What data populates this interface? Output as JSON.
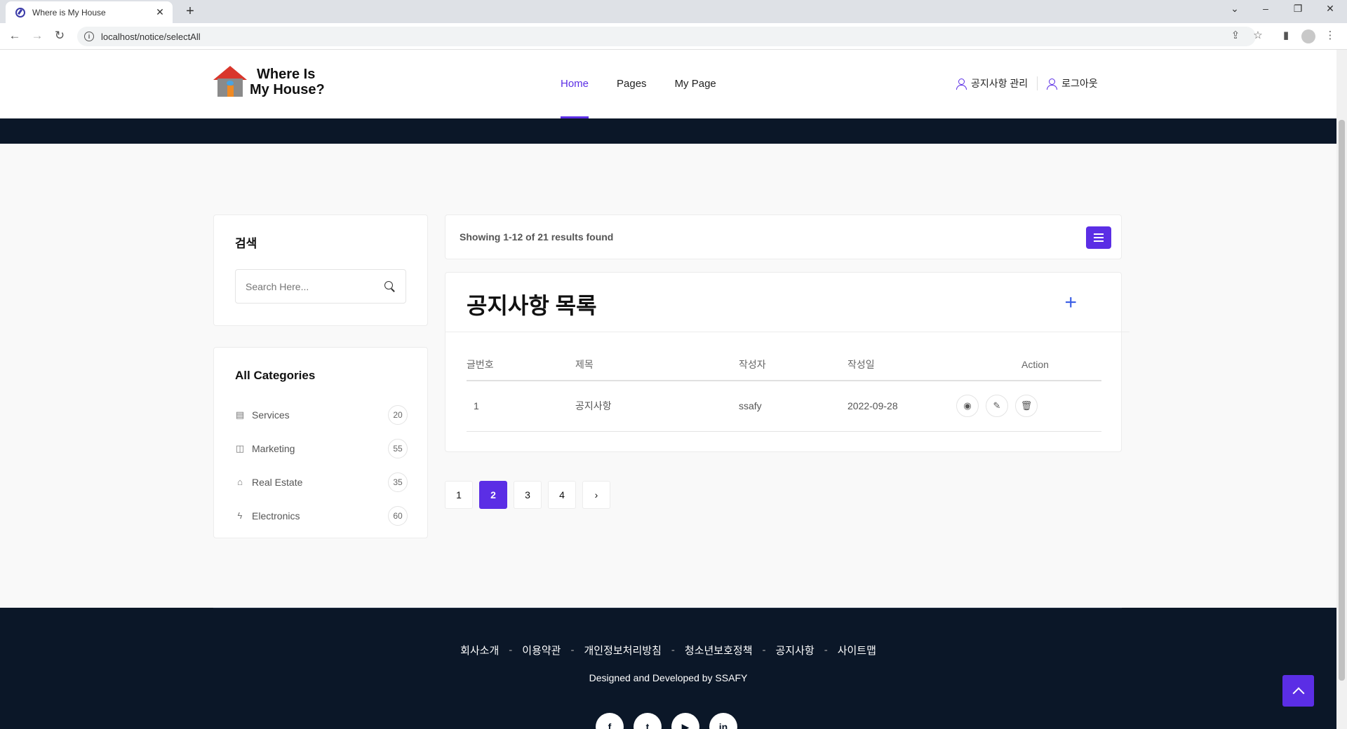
{
  "browser": {
    "tab_title": "Where is My House",
    "url": "localhost/notice/selectAll"
  },
  "header": {
    "logo_line1": "Where Is",
    "logo_line2": "My House?",
    "nav": [
      {
        "label": "Home"
      },
      {
        "label": "Pages"
      },
      {
        "label": "My Page"
      }
    ],
    "notice_admin": "공지사항 관리",
    "logout": "로그아웃"
  },
  "sidebar": {
    "search_title": "검색",
    "search_placeholder": "Search Here...",
    "categories_title": "All Categories",
    "categories": [
      {
        "label": "Services",
        "count": "20",
        "icon": "document-icon"
      },
      {
        "label": "Marketing",
        "count": "55",
        "icon": "megaphone-icon"
      },
      {
        "label": "Real Estate",
        "count": "35",
        "icon": "home-icon"
      },
      {
        "label": "Electronics",
        "count": "60",
        "icon": "lightning-icon"
      }
    ]
  },
  "main": {
    "result_text": "Showing 1-12 of 21 results found",
    "table_title": "공지사항 목록",
    "columns": [
      "글번호",
      "제목",
      "작성자",
      "작성일",
      "Action"
    ],
    "rows": [
      {
        "no": "1",
        "title": "공지사항",
        "author": "ssafy",
        "date": "2022-09-28"
      }
    ],
    "pages": [
      "1",
      "2",
      "3",
      "4"
    ],
    "active_page": "2"
  },
  "footer": {
    "links": [
      "회사소개",
      "이용약관",
      "개인정보처리방침",
      "청소년보호정책",
      "공지사항",
      "사이트맵"
    ],
    "separator": "-",
    "credit": "Designed and Developed by SSAFY",
    "social": [
      "facebook-icon",
      "twitter-icon",
      "youtube-icon",
      "linkedin-icon"
    ]
  },
  "colors": {
    "accent": "#5b2ee5",
    "dark": "#0b1728"
  }
}
